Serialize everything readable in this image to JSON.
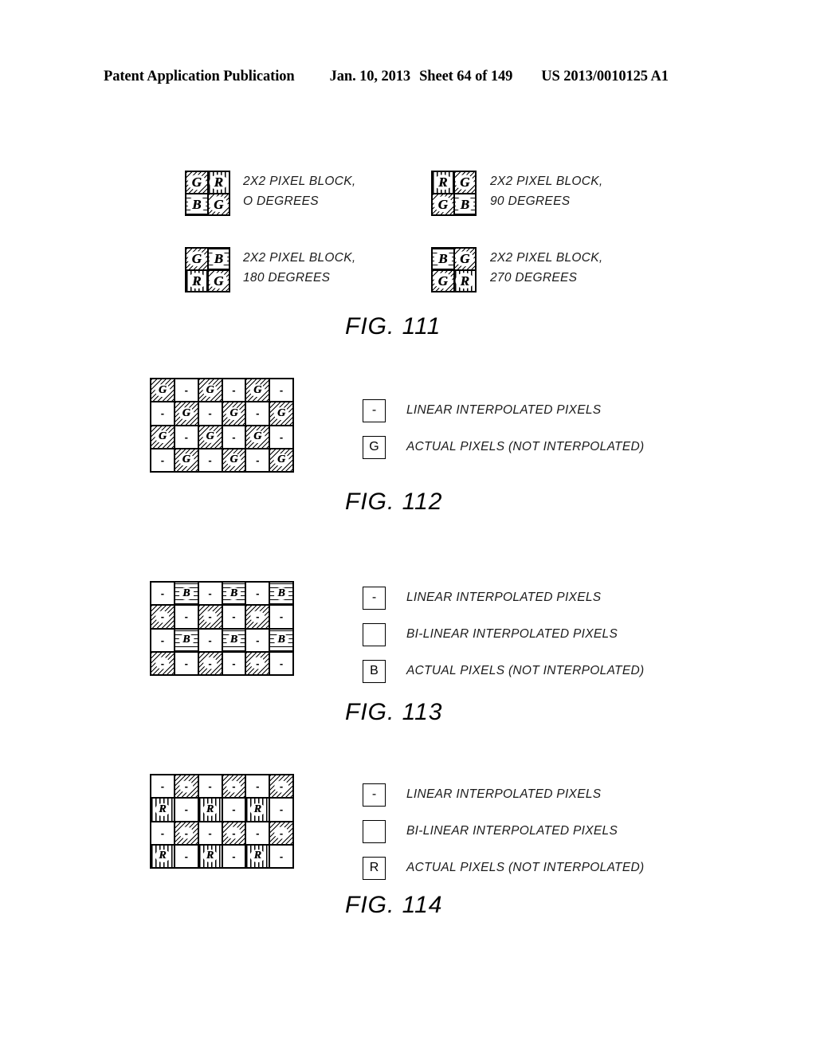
{
  "header": {
    "publication": "Patent Application Publication",
    "date": "Jan. 10, 2013",
    "sheet": "Sheet 64 of 149",
    "patent_number": "US 2013/0010125 A1"
  },
  "legend_swatch_labels": {
    "linear": "LINEAR INTERPOLATED PIXELS",
    "bilinear": "BI-LINEAR INTERPOLATED PIXELS",
    "actual": "ACTUAL PIXELS (NOT INTERPOLATED)"
  },
  "fill_types": {
    "diagonal": "diagonal-hatch",
    "vertical": "vertical-line-hatch",
    "horizontal": "horizontal-line-hatch",
    "white": "no-fill"
  },
  "fig111": {
    "caption": "FIG. 111",
    "blocks": [
      {
        "id": "block-0-degrees",
        "label": "2X2 PIXEL BLOCK,\nO DEGREES",
        "cells": [
          {
            "glyph": "G",
            "fill": "diagonal"
          },
          {
            "glyph": "R",
            "fill": "vertical"
          },
          {
            "glyph": "B",
            "fill": "horizontal"
          },
          {
            "glyph": "G",
            "fill": "diagonal"
          }
        ]
      },
      {
        "id": "block-90-degrees",
        "label": "2X2 PIXEL BLOCK,\n90 DEGREES",
        "cells": [
          {
            "glyph": "R",
            "fill": "vertical"
          },
          {
            "glyph": "G",
            "fill": "diagonal"
          },
          {
            "glyph": "G",
            "fill": "diagonal"
          },
          {
            "glyph": "B",
            "fill": "horizontal"
          }
        ]
      },
      {
        "id": "block-180-degrees",
        "label": "2X2 PIXEL BLOCK,\n180 DEGREES",
        "cells": [
          {
            "glyph": "G",
            "fill": "diagonal"
          },
          {
            "glyph": "B",
            "fill": "horizontal"
          },
          {
            "glyph": "R",
            "fill": "vertical"
          },
          {
            "glyph": "G",
            "fill": "diagonal"
          }
        ]
      },
      {
        "id": "block-270-degrees",
        "label": "2X2 PIXEL BLOCK,\n270 DEGREES",
        "cells": [
          {
            "glyph": "B",
            "fill": "horizontal"
          },
          {
            "glyph": "G",
            "fill": "diagonal"
          },
          {
            "glyph": "G",
            "fill": "diagonal"
          },
          {
            "glyph": "R",
            "fill": "vertical"
          }
        ]
      }
    ]
  },
  "fig112": {
    "caption": "FIG. 112",
    "grid": {
      "rows": 4,
      "cols": 6,
      "cells": [
        {
          "glyph": "G",
          "fill": "diagonal"
        },
        {
          "glyph": "-",
          "fill": "white"
        },
        {
          "glyph": "G",
          "fill": "diagonal"
        },
        {
          "glyph": "-",
          "fill": "white"
        },
        {
          "glyph": "G",
          "fill": "diagonal"
        },
        {
          "glyph": "-",
          "fill": "white"
        },
        {
          "glyph": "-",
          "fill": "white"
        },
        {
          "glyph": "G",
          "fill": "diagonal"
        },
        {
          "glyph": "-",
          "fill": "white"
        },
        {
          "glyph": "G",
          "fill": "diagonal"
        },
        {
          "glyph": "-",
          "fill": "white"
        },
        {
          "glyph": "G",
          "fill": "diagonal"
        },
        {
          "glyph": "G",
          "fill": "diagonal"
        },
        {
          "glyph": "-",
          "fill": "white"
        },
        {
          "glyph": "G",
          "fill": "diagonal"
        },
        {
          "glyph": "-",
          "fill": "white"
        },
        {
          "glyph": "G",
          "fill": "diagonal"
        },
        {
          "glyph": "-",
          "fill": "white"
        },
        {
          "glyph": "-",
          "fill": "white"
        },
        {
          "glyph": "G",
          "fill": "diagonal"
        },
        {
          "glyph": "-",
          "fill": "white"
        },
        {
          "glyph": "G",
          "fill": "diagonal"
        },
        {
          "glyph": "-",
          "fill": "white"
        },
        {
          "glyph": "G",
          "fill": "diagonal"
        }
      ]
    },
    "legend": [
      {
        "glyph": "-",
        "fill": "white",
        "label": "LINEAR INTERPOLATED PIXELS"
      },
      {
        "glyph": "G",
        "fill": "diagonal",
        "label": "ACTUAL PIXELS (NOT INTERPOLATED)"
      }
    ]
  },
  "fig113": {
    "caption": "FIG. 113",
    "grid": {
      "rows": 4,
      "cols": 6,
      "cells": [
        {
          "glyph": "-",
          "fill": "white"
        },
        {
          "glyph": "B",
          "fill": "horizontal"
        },
        {
          "glyph": "-",
          "fill": "white"
        },
        {
          "glyph": "B",
          "fill": "horizontal"
        },
        {
          "glyph": "-",
          "fill": "white"
        },
        {
          "glyph": "B",
          "fill": "horizontal"
        },
        {
          "glyph": "-",
          "fill": "diagonal"
        },
        {
          "glyph": "-",
          "fill": "white"
        },
        {
          "glyph": "-",
          "fill": "diagonal"
        },
        {
          "glyph": "-",
          "fill": "white"
        },
        {
          "glyph": "-",
          "fill": "diagonal"
        },
        {
          "glyph": "-",
          "fill": "white"
        },
        {
          "glyph": "-",
          "fill": "white"
        },
        {
          "glyph": "B",
          "fill": "horizontal"
        },
        {
          "glyph": "-",
          "fill": "white"
        },
        {
          "glyph": "B",
          "fill": "horizontal"
        },
        {
          "glyph": "-",
          "fill": "white"
        },
        {
          "glyph": "B",
          "fill": "horizontal"
        },
        {
          "glyph": "-",
          "fill": "diagonal"
        },
        {
          "glyph": "-",
          "fill": "white"
        },
        {
          "glyph": "-",
          "fill": "diagonal"
        },
        {
          "glyph": "-",
          "fill": "white"
        },
        {
          "glyph": "-",
          "fill": "diagonal"
        },
        {
          "glyph": "-",
          "fill": "white"
        }
      ]
    },
    "legend": [
      {
        "glyph": "-",
        "fill": "white",
        "label": "LINEAR INTERPOLATED PIXELS"
      },
      {
        "glyph": "",
        "fill": "diagonal",
        "label": "BI-LINEAR INTERPOLATED PIXELS"
      },
      {
        "glyph": "B",
        "fill": "horizontal",
        "label": "ACTUAL PIXELS (NOT INTERPOLATED)"
      }
    ]
  },
  "fig114": {
    "caption": "FIG. 114",
    "grid": {
      "rows": 4,
      "cols": 6,
      "cells": [
        {
          "glyph": "-",
          "fill": "white"
        },
        {
          "glyph": "-",
          "fill": "diagonal"
        },
        {
          "glyph": "-",
          "fill": "white"
        },
        {
          "glyph": "-",
          "fill": "diagonal"
        },
        {
          "glyph": "-",
          "fill": "white"
        },
        {
          "glyph": "-",
          "fill": "diagonal"
        },
        {
          "glyph": "R",
          "fill": "vertical"
        },
        {
          "glyph": "-",
          "fill": "white"
        },
        {
          "glyph": "R",
          "fill": "vertical"
        },
        {
          "glyph": "-",
          "fill": "white"
        },
        {
          "glyph": "R",
          "fill": "vertical"
        },
        {
          "glyph": "-",
          "fill": "white"
        },
        {
          "glyph": "-",
          "fill": "white"
        },
        {
          "glyph": "-",
          "fill": "diagonal"
        },
        {
          "glyph": "-",
          "fill": "white"
        },
        {
          "glyph": "-",
          "fill": "diagonal"
        },
        {
          "glyph": "-",
          "fill": "white"
        },
        {
          "glyph": "-",
          "fill": "diagonal"
        },
        {
          "glyph": "R",
          "fill": "vertical"
        },
        {
          "glyph": "-",
          "fill": "white"
        },
        {
          "glyph": "R",
          "fill": "vertical"
        },
        {
          "glyph": "-",
          "fill": "white"
        },
        {
          "glyph": "R",
          "fill": "vertical"
        },
        {
          "glyph": "-",
          "fill": "white"
        }
      ]
    },
    "legend": [
      {
        "glyph": "-",
        "fill": "white",
        "label": "LINEAR INTERPOLATED PIXELS"
      },
      {
        "glyph": "",
        "fill": "diagonal",
        "label": "BI-LINEAR INTERPOLATED PIXELS"
      },
      {
        "glyph": "R",
        "fill": "vertical",
        "label": "ACTUAL PIXELS (NOT INTERPOLATED)"
      }
    ]
  }
}
